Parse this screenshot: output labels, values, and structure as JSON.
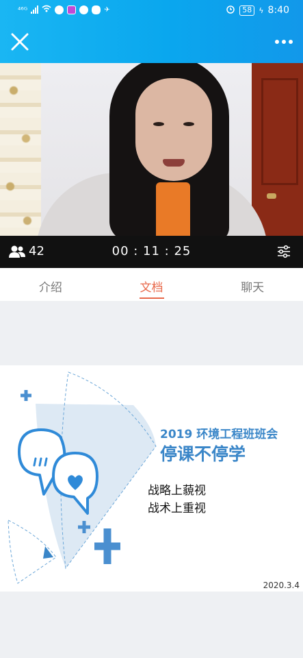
{
  "status_bar": {
    "left_text": "⁴⁶ᴳ",
    "battery": "58",
    "time": "8:40"
  },
  "header": {
    "close_icon": "close-icon",
    "more_icon": "more-dots-icon"
  },
  "video_bar": {
    "viewer_count": "42",
    "timer": "00 : 11 : 25",
    "settings_icon": "sliders-icon"
  },
  "tabs": [
    {
      "label": "介绍",
      "active": false
    },
    {
      "label": "文档",
      "active": true
    },
    {
      "label": "聊天",
      "active": false
    }
  ],
  "slide": {
    "title_line1": "2019 环境工程班班会",
    "title_line2": "停课不停学",
    "lines": [
      "战略上藐视",
      "战术上重视"
    ],
    "date": "2020.3.4",
    "accent_color": "#3a86c8"
  },
  "colors": {
    "header_bg": "#0aa7ee",
    "active_tab": "#e8684a"
  }
}
